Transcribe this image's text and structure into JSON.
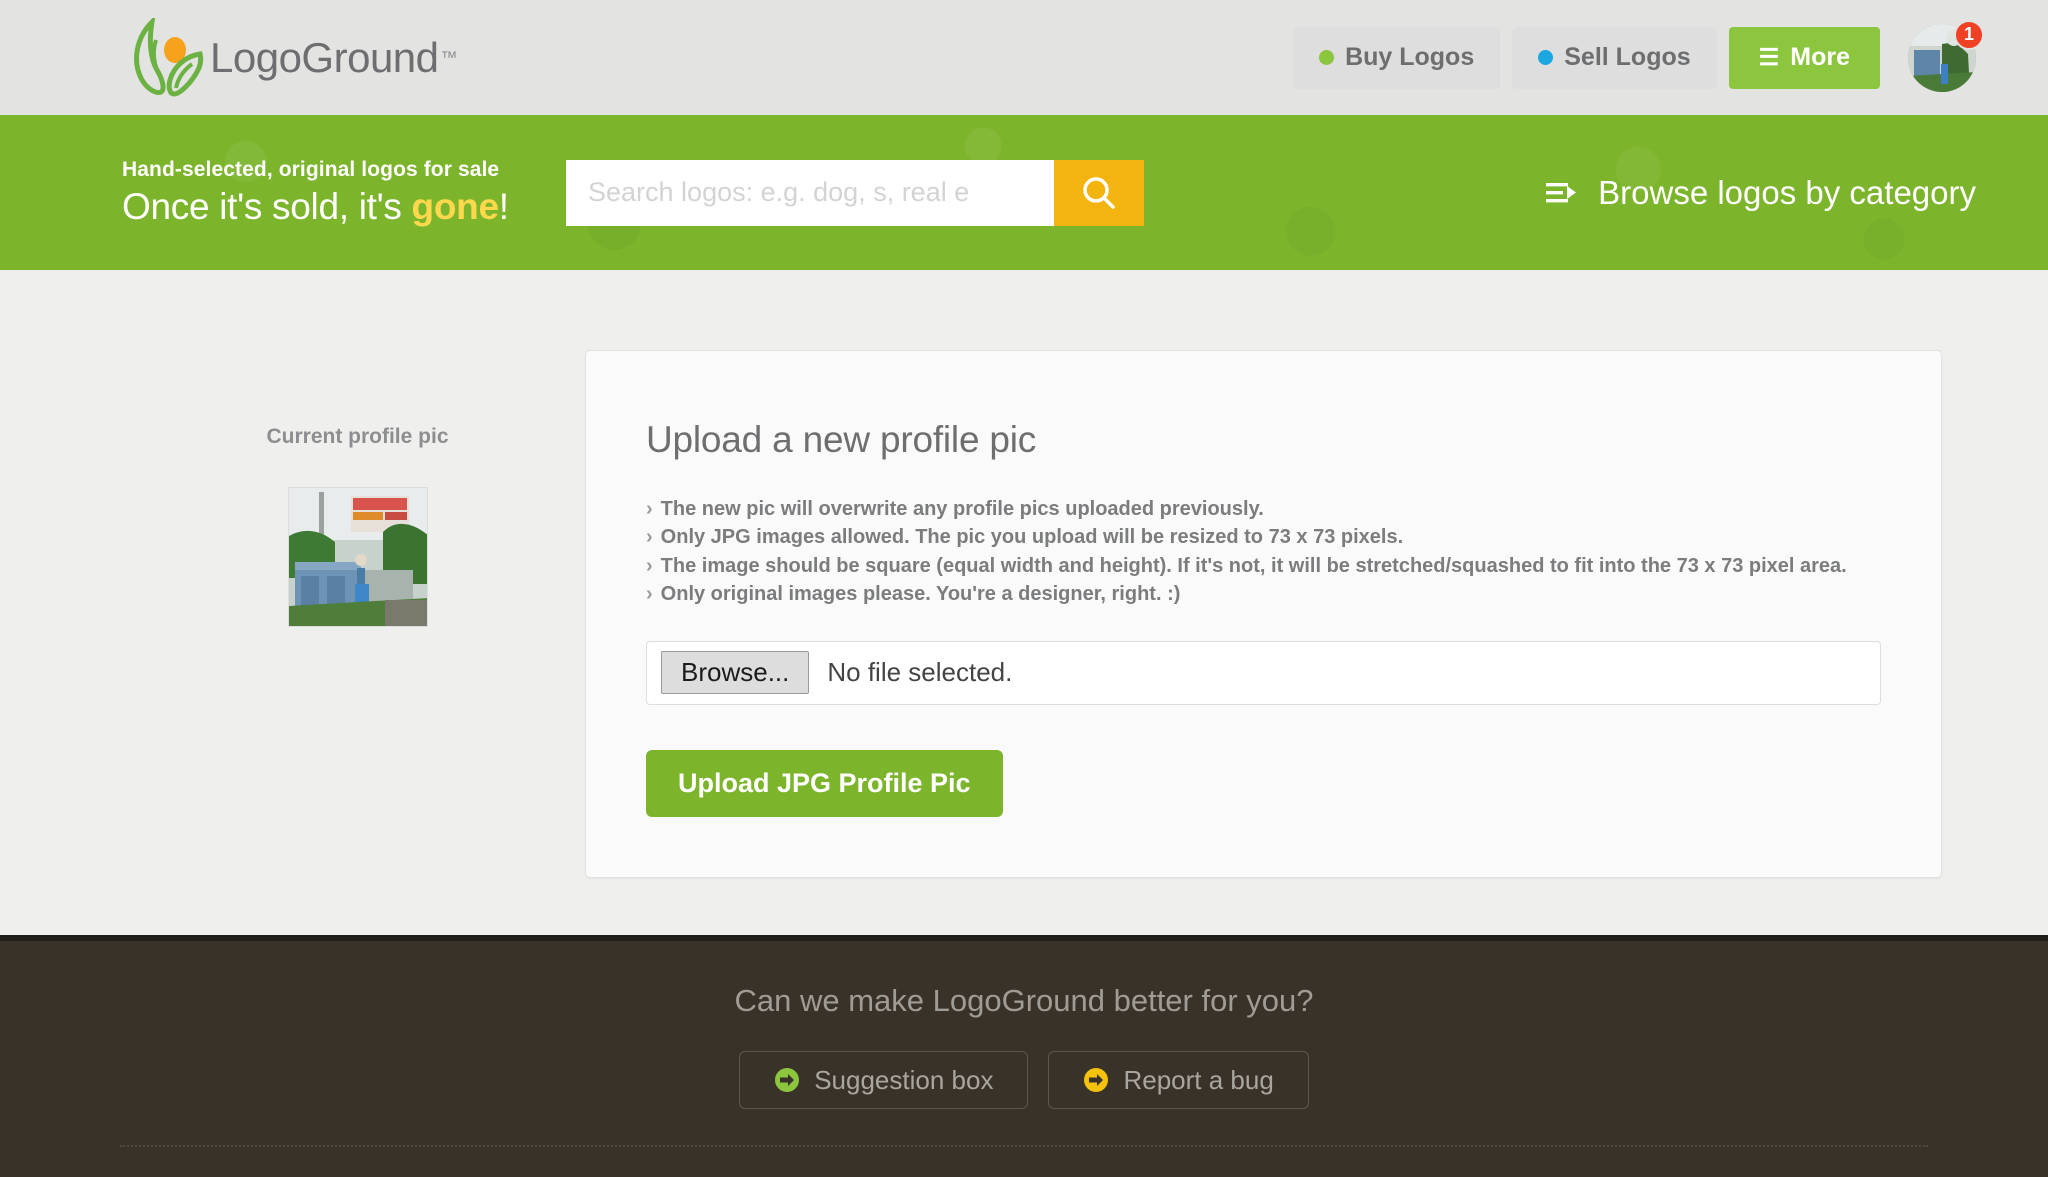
{
  "header": {
    "brand_name": "LogoGround",
    "brand_tm": "™",
    "nav": [
      {
        "label": "Buy Logos",
        "dot_color": "#8cc63f",
        "icon": "dot-icon"
      },
      {
        "label": "Sell Logos",
        "dot_color": "#1ca7e0",
        "icon": "dot-icon"
      }
    ],
    "more_label": "More",
    "more_icon": "hamburger-icon",
    "avatar_icon": "user-avatar",
    "notification_count": "1"
  },
  "search_band": {
    "tagline_small": "Hand-selected, original logos for sale",
    "tagline_big_prefix": "Once it's sold, it's ",
    "tagline_big_accent": "gone",
    "tagline_big_suffix": "!",
    "search_placeholder": "Search logos: e.g. dog, s, real e",
    "search_value": "",
    "search_icon": "magnifier-icon",
    "browse_label": "Browse logos by category",
    "browse_icon": "list-arrow-icon",
    "band_color": "#7cb52c",
    "search_button_color": "#f4b40f",
    "accent_color": "#ffd84d"
  },
  "sidebar": {
    "current_pic_label": "Current profile pic",
    "current_pic_icon": "profile-photo"
  },
  "card": {
    "title": "Upload a new profile pic",
    "bullets": [
      "The new pic will overwrite any profile pics uploaded previously.",
      "Only JPG images allowed. The pic you upload will be resized to 73 x 73 pixels.",
      "The image should be square (equal width and height). If it's not, it will be stretched/squashed to fit into the 73 x 73 pixel area.",
      "Only original images please. You're a designer, right. :)"
    ],
    "bullet_marker": "›",
    "file_browse_label": "Browse...",
    "file_status": "No file selected.",
    "upload_button_label": "Upload JPG Profile Pic",
    "upload_button_color": "#7cb52c"
  },
  "footer": {
    "question": "Can we make LogoGround better for you?",
    "buttons": [
      {
        "label": "Suggestion box",
        "icon": "arrow-circle-green-icon",
        "color": "#8cc63f"
      },
      {
        "label": "Report a bug",
        "icon": "arrow-circle-yellow-icon",
        "color": "#f4c20d"
      }
    ],
    "background_color": "#383229"
  }
}
